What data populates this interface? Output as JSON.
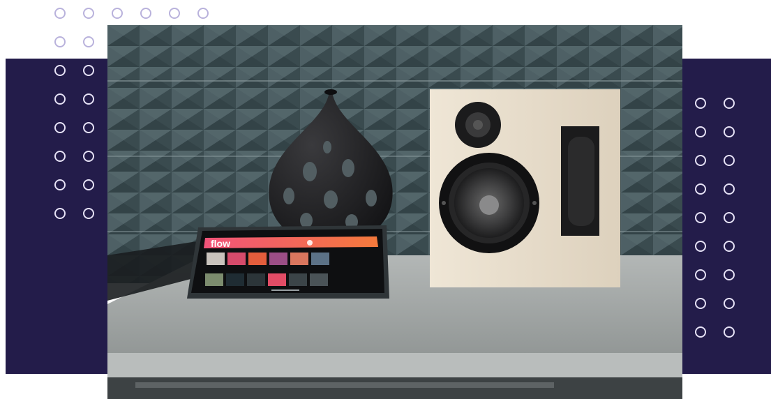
{
  "scene": {
    "description_tags": [
      "bookshelf-speaker",
      "decorative-vase",
      "tablet",
      "tiled-wall",
      "countertop"
    ],
    "tablet_app": {
      "app_name": "flow",
      "rows": 2
    }
  },
  "colors": {
    "panel": "#231c4a",
    "dot_on_white": "#b9b2dc",
    "dot_on_panel": "#e6e2f6",
    "tile": "#4d5f64",
    "tile_dark": "#3b4b50",
    "counter": "#9ea3a2",
    "speaker_wood": "#e9dfcd",
    "vase": "#1d1d1f",
    "flow_gradient_start": "#f1537a",
    "flow_gradient_end": "#f47a3c"
  },
  "decor": {
    "top_dot_rows": [
      6,
      2
    ],
    "left_panel_dot_rows": 6,
    "left_panel_dot_cols": 2,
    "right_panel_dot_rows": 9,
    "right_panel_dot_cols": 2
  }
}
